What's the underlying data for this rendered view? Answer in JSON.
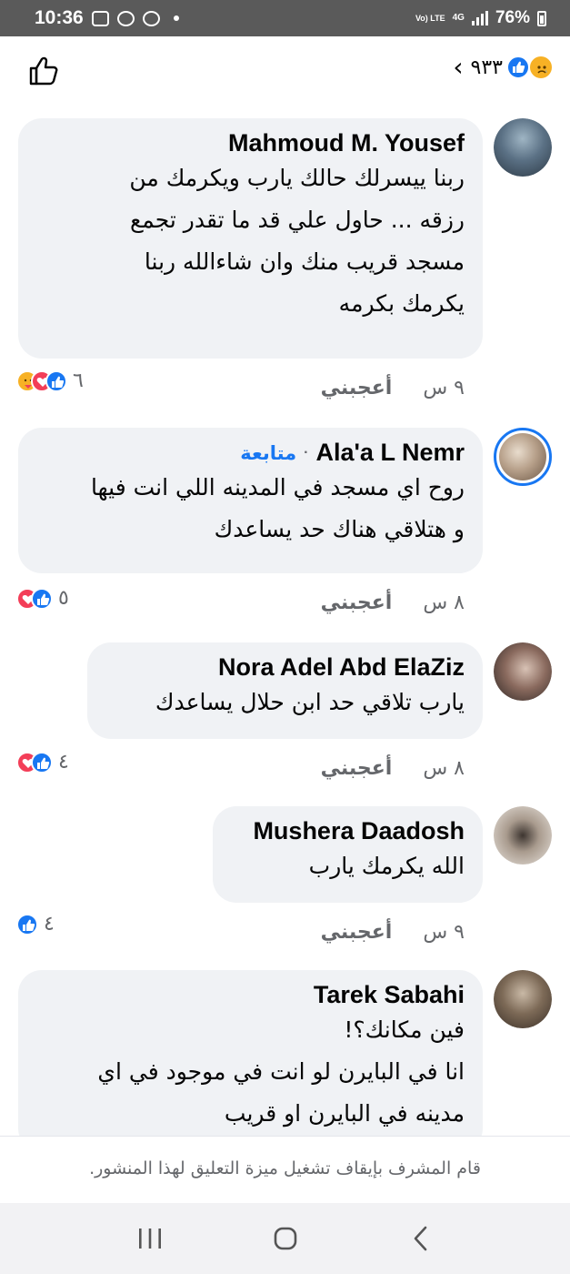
{
  "status": {
    "time": "10:36",
    "volte": "Vo) LTE",
    "network": "4G",
    "battery": "76%"
  },
  "header": {
    "reaction_count": "٩٣٣",
    "back_icon": "chevron-left-icon",
    "like_icon": "thumbs-up-outline-icon"
  },
  "comments": [
    {
      "name": "Mahmoud M. Yousef",
      "lines": [
        "ربنا ييسرلك حالك يارب ويكرمك من",
        "رزقه ... حاول علي قد ما تقدر تجمع",
        "مسجد قريب منك وان شاءالله ربنا",
        "يكرمك بكرمه"
      ],
      "time": "٩ س",
      "like_label": "أعجبني",
      "reaction_count": "٦",
      "reactions": [
        "care",
        "love",
        "like"
      ]
    },
    {
      "name": "Ala'a L Nemr",
      "follow": "متابعة",
      "separator": "·",
      "lines": [
        "روح اي مسجد في المدينه اللي انت فيها",
        "و هتلاقي هناك حد يساعدك"
      ],
      "time": "٨ س",
      "like_label": "أعجبني",
      "reaction_count": "٥",
      "reactions": [
        "love",
        "like"
      ]
    },
    {
      "name": "Nora Adel Abd ElaZiz",
      "lines": [
        "يارب تلاقي حد ابن حلال يساعدك"
      ],
      "time": "٨ س",
      "like_label": "أعجبني",
      "reaction_count": "٤",
      "reactions": [
        "love",
        "like"
      ]
    },
    {
      "name": "Mushera Daadosh",
      "lines": [
        "الله يكرمك يارب"
      ],
      "time": "٩ س",
      "like_label": "أعجبني",
      "reaction_count": "٤",
      "reactions": [
        "like"
      ]
    },
    {
      "name": "Tarek Sabahi",
      "lines": [
        "فين مكانك؟!",
        "انا في البايرن لو انت في موجود في اي",
        "مدينه في البايرن او قريب"
      ]
    }
  ],
  "footer": {
    "disabled_note": "قام المشرف بإيقاف تشغيل ميزة التعليق لهذا المنشور."
  },
  "nav": {
    "recents_icon": "recents-icon",
    "home_icon": "home-icon",
    "back_icon": "back-icon"
  },
  "colors": {
    "accent": "#1877f2",
    "love": "#f33e58",
    "bubble": "#f0f2f5",
    "secondary_text": "#65676b"
  }
}
